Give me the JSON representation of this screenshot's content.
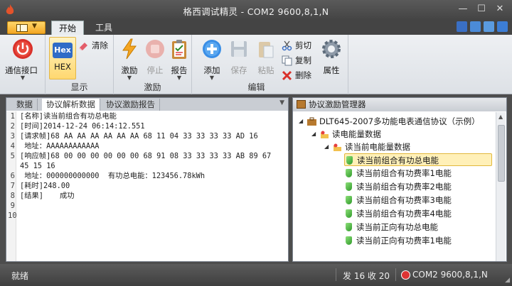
{
  "window": {
    "title": "格西调试精灵 - COM2  9600,8,1,N"
  },
  "ribbon_tabs": [
    {
      "label": "开始"
    },
    {
      "label": "工具"
    }
  ],
  "groups": {
    "connect": {
      "button": "通信接口"
    },
    "display": {
      "label": "显示",
      "hex": "Hex",
      "hex_label": "HEX",
      "clear": "清除"
    },
    "stimulus": {
      "label": "激励",
      "stimulate": "激励",
      "stop": "停止",
      "report": "报告"
    },
    "edit": {
      "label": "编辑",
      "add": "添加",
      "save": "保存",
      "paste": "粘贴",
      "cut": "剪切",
      "copy": "复制",
      "delete": "删除",
      "properties": "属性"
    }
  },
  "left_panel": {
    "tabs": [
      {
        "label": "数据"
      },
      {
        "label": "协议解析数据"
      },
      {
        "label": "协议激励报告"
      }
    ],
    "line_numbers": [
      "1",
      "2",
      "3",
      "4",
      "5",
      "6",
      "7",
      "8",
      "9",
      "10"
    ],
    "lines": [
      "[名称]读当前组合有功总电能",
      "[时间]2014-12-24 06:14:12.551",
      "[请求帧]68 AA AA AA AA AA AA 68 11 04 33 33 33 33 AD 16",
      " 地址：AAAAAAAAAAAA",
      "[响应帧]68 00 00 00 00 00 00 68 91 08 33 33 33 33 AB 89 67",
      "45 15 16",
      " 地址：000000000000  有功总电能：123456.78kWh",
      "[耗时]248.00",
      "[结果]",
      "成功"
    ]
  },
  "right_panel": {
    "title": "协议激励管理器",
    "tree": [
      {
        "label": "DLT645-2007多功能电表通信协议（示例）"
      },
      {
        "label": "读电能量数据"
      },
      {
        "label": "读当前电能量数据"
      },
      {
        "label": "读当前组合有功总电能"
      },
      {
        "label": "读当前组合有功费率1电能"
      },
      {
        "label": "读当前组合有功费率2电能"
      },
      {
        "label": "读当前组合有功费率3电能"
      },
      {
        "label": "读当前组合有功费率4电能"
      },
      {
        "label": "读当前正向有功总电能"
      },
      {
        "label": "读当前正向有功费率1电能"
      }
    ]
  },
  "status": {
    "ready": "就绪",
    "counts": "发 16  收 20",
    "port": "COM2  9600,8,1,N"
  },
  "colors": {
    "title_bg": "#4a4a4a",
    "accent": "#f4a623",
    "success": "#14a01a",
    "selected_bg": "#fff0b8"
  }
}
